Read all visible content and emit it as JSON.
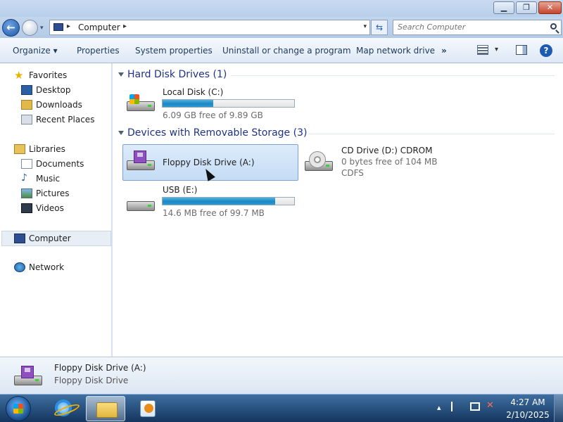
{
  "window": {
    "min_glyph": "▁",
    "max_glyph": "❐",
    "close_glyph": "✕"
  },
  "nav": {
    "back_glyph": "←",
    "recent_glyph": "▾",
    "address": "Computer",
    "address_chevron": "▸",
    "dropdown_glyph": "▾",
    "refresh_glyph": "⇆",
    "search_placeholder": "Search Computer"
  },
  "commands": {
    "organize": "Organize ▾",
    "properties": "Properties",
    "system_properties": "System properties",
    "uninstall": "Uninstall or change a program",
    "map_drive": "Map network drive",
    "more": "»",
    "views_drop": "▾",
    "help": "?"
  },
  "sidebar": {
    "favorites": "Favorites",
    "desktop": "Desktop",
    "downloads": "Downloads",
    "recent_places": "Recent Places",
    "libraries": "Libraries",
    "documents": "Documents",
    "music": "Music",
    "pictures": "Pictures",
    "videos": "Videos",
    "computer": "Computer",
    "network": "Network"
  },
  "groups": {
    "hdd": "Hard Disk Drives (1)",
    "removable": "Devices with Removable Storage (3)"
  },
  "drives": {
    "local_c": {
      "name": "Local Disk (C:)",
      "free": "6.09 GB free of 9.89 GB",
      "used_fraction": 0.384
    },
    "floppy_a": {
      "name": "Floppy Disk Drive (A:)"
    },
    "cd_d": {
      "name": "CD Drive (D:) CDROM",
      "free": "0 bytes free of 104 MB",
      "fs": "CDFS"
    },
    "usb_e": {
      "name": "USB (E:)",
      "free": "14.6 MB free of 99.7 MB",
      "used_fraction": 0.854
    }
  },
  "details": {
    "name": "Floppy Disk Drive (A:)",
    "type": "Floppy Disk Drive"
  },
  "taskbar": {
    "time": "4:27 AM",
    "date": "2/10/2025",
    "tray_up": "▴"
  },
  "colors": {
    "accent": "#1b86c4",
    "group_heading": "#1e3287",
    "selection": "#c4dcf5"
  }
}
